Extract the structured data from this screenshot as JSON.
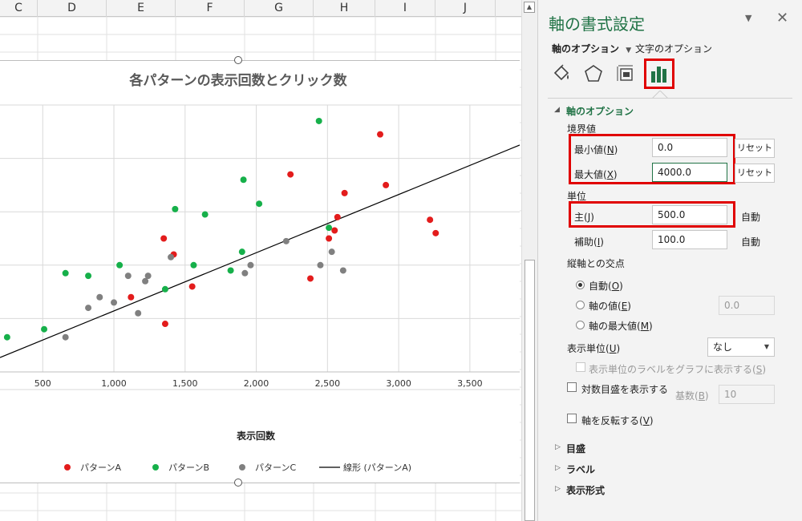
{
  "sheet": {
    "columns": [
      "C",
      "D",
      "E",
      "F",
      "G",
      "H",
      "I",
      "J"
    ]
  },
  "chart": {
    "colors": {
      "A": "#e31c1c",
      "B": "#16b04a",
      "C": "#808080",
      "trend": "#000000"
    },
    "legend": [
      "パターンA",
      "パターンB",
      "パターンC",
      "線形 (パターンA)"
    ]
  },
  "chart_data": {
    "type": "scatter",
    "title": "各パターンの表示回数とクリック数",
    "xlabel": "表示回数",
    "ylabel": "",
    "xticks": [
      "500",
      "1,000",
      "1,500",
      "2,000",
      "2,500",
      "3,000",
      "3,500"
    ],
    "xlim": [
      200,
      3850
    ],
    "ylim": [
      0,
      100
    ],
    "grid": true,
    "legend_position": "bottom",
    "series": [
      {
        "name": "パターンA",
        "points": [
          [
            1120,
            28
          ],
          [
            1350,
            50
          ],
          [
            1360,
            18
          ],
          [
            1420,
            44
          ],
          [
            1550,
            32
          ],
          [
            2240,
            74
          ],
          [
            2380,
            35
          ],
          [
            2510,
            50
          ],
          [
            2550,
            53
          ],
          [
            2570,
            58
          ],
          [
            2620,
            67
          ],
          [
            2870,
            89
          ],
          [
            2910,
            70
          ],
          [
            3220,
            57
          ],
          [
            3260,
            52
          ]
        ]
      },
      {
        "name": "パターンB",
        "points": [
          [
            250,
            13
          ],
          [
            510,
            16
          ],
          [
            660,
            37
          ],
          [
            820,
            36
          ],
          [
            1040,
            40
          ],
          [
            1360,
            31
          ],
          [
            1430,
            61
          ],
          [
            1560,
            40
          ],
          [
            1640,
            59
          ],
          [
            1820,
            38
          ],
          [
            1900,
            45
          ],
          [
            1910,
            72
          ],
          [
            2020,
            63
          ],
          [
            2440,
            94
          ],
          [
            2510,
            54
          ]
        ]
      },
      {
        "name": "パターンC",
        "points": [
          [
            660,
            13
          ],
          [
            820,
            24
          ],
          [
            900,
            28
          ],
          [
            1000,
            26
          ],
          [
            1100,
            36
          ],
          [
            1170,
            22
          ],
          [
            1220,
            34
          ],
          [
            1240,
            36
          ],
          [
            1400,
            43
          ],
          [
            1920,
            37
          ],
          [
            1960,
            40
          ],
          [
            2210,
            49
          ],
          [
            2450,
            40
          ],
          [
            2530,
            45
          ],
          [
            2610,
            38
          ]
        ]
      }
    ],
    "trendline": {
      "name": "線形 (パターンA)",
      "x": [
        200,
        3850
      ],
      "y": [
        5.4,
        85
      ]
    }
  },
  "panel": {
    "title": "軸の書式設定",
    "tab_axis": "軸のオプション",
    "tab_text": "文字のオプション",
    "section_axis": "軸のオプション",
    "bounds_label": "境界値",
    "min_label": "最小値(",
    "min_key": "N",
    "min_value": "0.0",
    "max_label": "最大値(",
    "max_key": "X",
    "max_value": "4000.0",
    "reset": "リセット",
    "units_label": "単位",
    "major_label": "主(",
    "major_key": "J",
    "major_value": "500.0",
    "auto": "自動",
    "minor_label": "補助(",
    "minor_key": "I",
    "minor_value": "100.0",
    "cross_label": "縦軸との交点",
    "cross_auto": "自動(",
    "cross_auto_key": "O",
    "cross_value": "軸の値(",
    "cross_value_key": "E",
    "cross_value_field": "0.0",
    "cross_max": "軸の最大値(",
    "cross_max_key": "M",
    "display_units": "表示単位(",
    "display_units_key": "U",
    "display_units_value": "なし",
    "show_units_label": "表示単位のラベルをグラフに表示する(",
    "show_units_key": "S",
    "log_scale": "対数目盛を表示する",
    "base_label": "基数(",
    "base_key": "B",
    "base_value": "10",
    "reverse": "軸を反転する(",
    "reverse_key": "V",
    "sec_ticks": "目盛",
    "sec_labels": "ラベル",
    "sec_number": "表示形式"
  }
}
